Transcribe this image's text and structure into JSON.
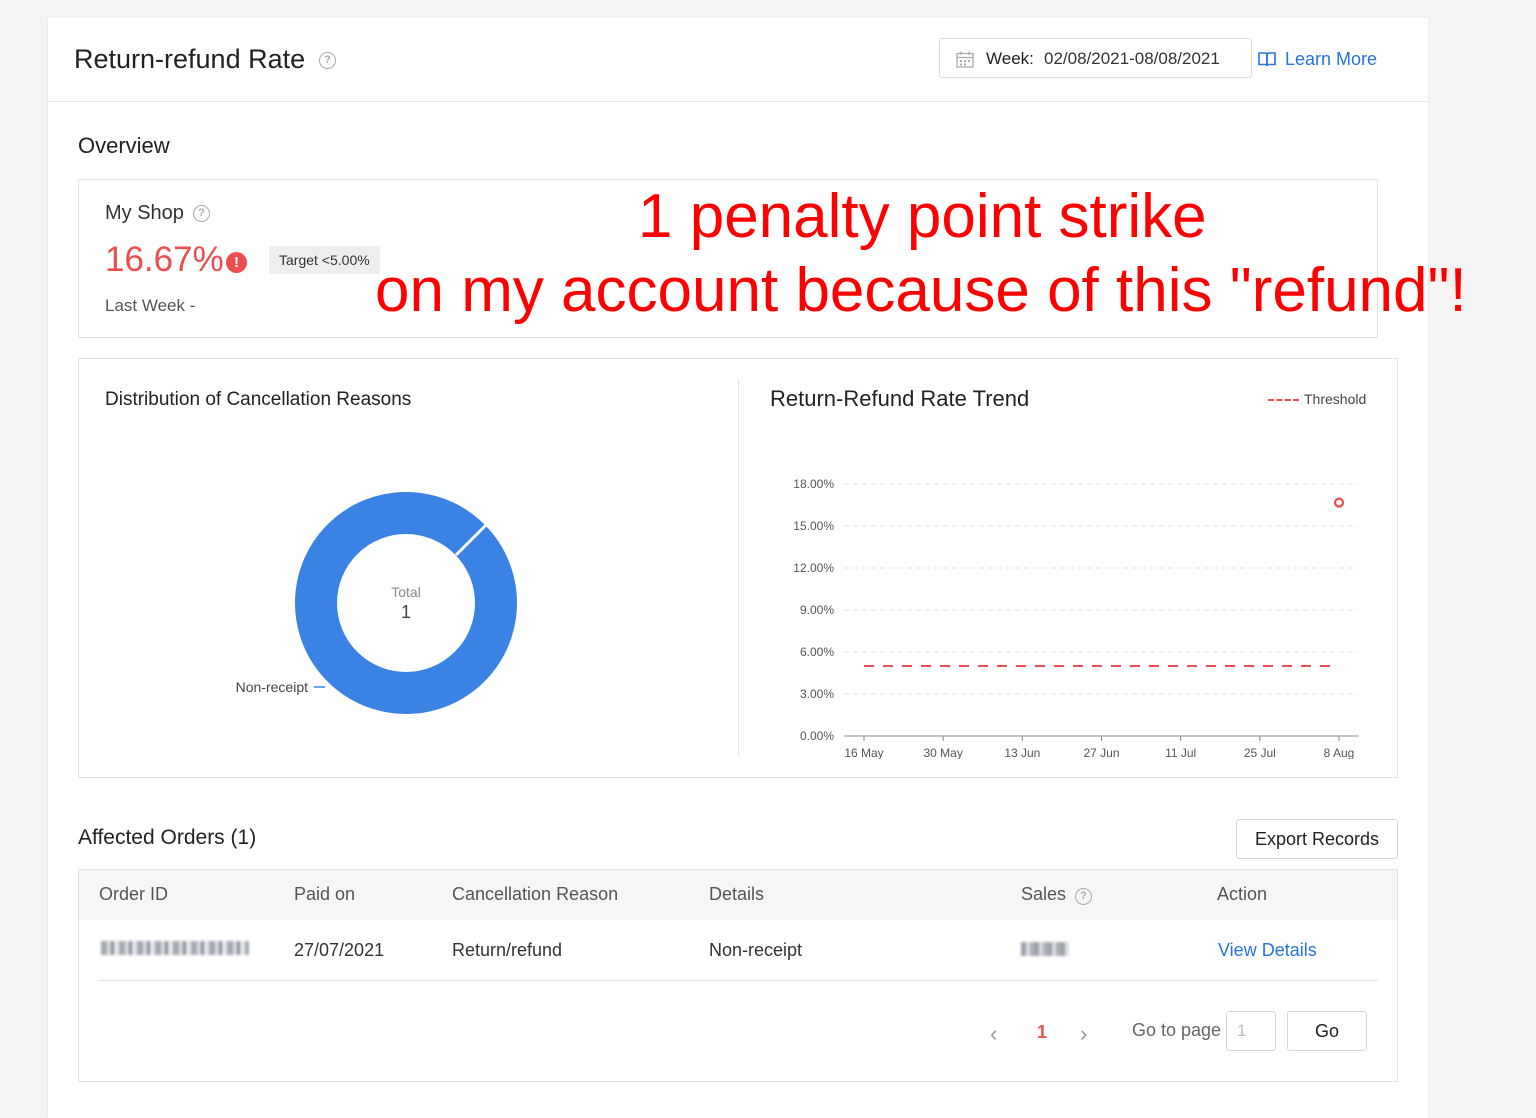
{
  "header": {
    "title": "Return-refund Rate",
    "week_label": "Week:",
    "week_value": "02/08/2021-08/08/2021",
    "learn_more": "Learn More"
  },
  "overview": {
    "title": "Overview",
    "shop_label": "My Shop",
    "rate": "16.67%",
    "target": "Target <5.00%",
    "last_week": "Last Week -"
  },
  "annotation": {
    "line1": "1 penalty point strike",
    "line2": "on my account because of this \"refund\"!"
  },
  "distribution": {
    "title": "Distribution of Cancellation Reasons",
    "center_label": "Total",
    "center_value": "1"
  },
  "trend": {
    "title": "Return-Refund Rate Trend",
    "legend_label": "Threshold"
  },
  "colors": {
    "accent": "#ee4d4d",
    "link": "#2673dd",
    "donut": "#3a82e4",
    "grid": "#e3e3e3"
  },
  "chart_data": [
    {
      "type": "pie",
      "title": "Distribution of Cancellation Reasons",
      "labels": [
        "Non-receipt"
      ],
      "values": [
        1
      ],
      "total": 1
    },
    {
      "type": "line",
      "title": "Return-Refund Rate Trend",
      "x": [
        "16 May",
        "30 May",
        "13 Jun",
        "27 Jun",
        "11 Jul",
        "25 Jul",
        "8 Aug"
      ],
      "yticks": [
        "0.00%",
        "3.00%",
        "6.00%",
        "9.00%",
        "12.00%",
        "15.00%",
        "18.00%"
      ],
      "ylim": [
        0,
        18
      ],
      "series": [
        {
          "name": "Threshold",
          "style": "dashed",
          "x_range": [
            "16 May",
            "8 Aug"
          ],
          "value": 5.0
        },
        {
          "points": [
            {
              "x": "8 Aug",
              "y": 16.67
            }
          ]
        }
      ],
      "grid": true,
      "legend_position": "top-right"
    }
  ],
  "orders": {
    "title": "Affected Orders (1)",
    "export_label": "Export Records",
    "columns": [
      "Order ID",
      "Paid on",
      "Cancellation Reason",
      "Details",
      "Sales",
      "Action"
    ],
    "rows": [
      {
        "paid_on": "27/07/2021",
        "reason": "Return/refund",
        "details": "Non-receipt",
        "action": "View Details"
      }
    ]
  },
  "pagination": {
    "prev": "‹",
    "current": "1",
    "next": "›",
    "goto_label": "Go to page",
    "goto_placeholder": "1",
    "go_label": "Go"
  }
}
